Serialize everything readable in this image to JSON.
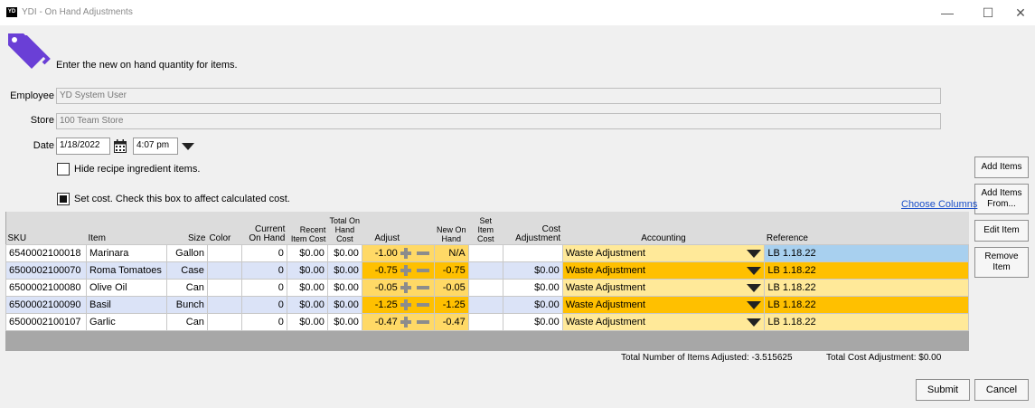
{
  "window": {
    "logo": "YD",
    "title": "YDI - On Hand Adjustments",
    "controls": [
      "minimize-icon",
      "maximize-icon",
      "close-icon"
    ]
  },
  "header": {
    "icon": "price-tags-icon",
    "instruction": "Enter the new on hand quantity for items."
  },
  "form": {
    "employee_label": "Employee",
    "employee_value": "YD System User",
    "store_label": "Store",
    "store_value": "100 Team Store",
    "date_label": "Date",
    "date_value": "1/18/2022",
    "time_value": "4:07 pm",
    "hide_recipe_label": "Hide recipe ingredient items.",
    "hide_recipe_checked": false,
    "set_cost_label": "Set cost. Check this box to affect calculated cost.",
    "set_cost_checked": true
  },
  "side_buttons": {
    "add_items": "Add Items",
    "add_items_from_1": "Add Items",
    "add_items_from_2": "From...",
    "edit_item": "Edit Item",
    "remove_item_1": "Remove",
    "remove_item_2": "Item"
  },
  "choose_columns": "Choose Columns",
  "table": {
    "headers": {
      "sku": "SKU",
      "item": "Item",
      "size": "Size",
      "color": "Color",
      "current_on_hand_1": "Current",
      "current_on_hand_2": "On Hand",
      "recent_item_cost_1": "Recent",
      "recent_item_cost_2": "Item Cost",
      "total_on_hand_cost_1": "Total On",
      "total_on_hand_cost_2": "Hand",
      "total_on_hand_cost_3": "Cost",
      "adjust": "Adjust",
      "new_on_hand_1": "New On",
      "new_on_hand_2": "Hand",
      "set_item_cost_1": "Set",
      "set_item_cost_2": "Item",
      "set_item_cost_3": "Cost",
      "cost_adjustment_1": "Cost",
      "cost_adjustment_2": "Adjustment",
      "accounting": "Accounting",
      "reference": "Reference"
    },
    "rows": [
      {
        "sku": "6540002100018",
        "item": "Marinara",
        "size": "Gallon",
        "color": "",
        "current": "0",
        "recent_cost": "$0.00",
        "total_cost": "$0.00",
        "adjust": "-1.00",
        "new_on_hand": "N/A",
        "set_cost": "",
        "cost_adjustment": "",
        "accounting": "Waste Adjustment",
        "reference": "LB 1.18.22"
      },
      {
        "sku": "6500002100070",
        "item": "Roma Tomatoes",
        "size": "Case",
        "color": "",
        "current": "0",
        "recent_cost": "$0.00",
        "total_cost": "$0.00",
        "adjust": "-0.75",
        "new_on_hand": "-0.75",
        "set_cost": "",
        "cost_adjustment": "$0.00",
        "accounting": "Waste Adjustment",
        "reference": "LB 1.18.22"
      },
      {
        "sku": "6500002100080",
        "item": "Olive Oil",
        "size": "Can",
        "color": "",
        "current": "0",
        "recent_cost": "$0.00",
        "total_cost": "$0.00",
        "adjust": "-0.05",
        "new_on_hand": "-0.05",
        "set_cost": "",
        "cost_adjustment": "$0.00",
        "accounting": "Waste Adjustment",
        "reference": "LB 1.18.22"
      },
      {
        "sku": "6500002100090",
        "item": "Basil",
        "size": "Bunch",
        "color": "",
        "current": "0",
        "recent_cost": "$0.00",
        "total_cost": "$0.00",
        "adjust": "-1.25",
        "new_on_hand": "-1.25",
        "set_cost": "",
        "cost_adjustment": "$0.00",
        "accounting": "Waste Adjustment",
        "reference": "LB 1.18.22"
      },
      {
        "sku": "6500002100107",
        "item": "Garlic",
        "size": "Can",
        "color": "",
        "current": "0",
        "recent_cost": "$0.00",
        "total_cost": "$0.00",
        "adjust": "-0.47",
        "new_on_hand": "-0.47",
        "set_cost": "",
        "cost_adjustment": "$0.00",
        "accounting": "Waste Adjustment",
        "reference": "LB 1.18.22"
      }
    ]
  },
  "totals": {
    "items_adjusted_label": "Total Number of Items Adjusted:",
    "items_adjusted_value": "-3.515625",
    "cost_adjustment_label": "Total Cost Adjustment:",
    "cost_adjustment_value": "$0.00"
  },
  "buttons": {
    "submit": "Submit",
    "cancel": "Cancel"
  },
  "colors": {
    "accent": "#6a3fd6",
    "adjust_light": "#ffd966",
    "adjust_dark": "#ffc000",
    "row_alt": "#dbe3f7",
    "selected_ref": "#a8d0ef",
    "link": "#1a4fc9"
  }
}
